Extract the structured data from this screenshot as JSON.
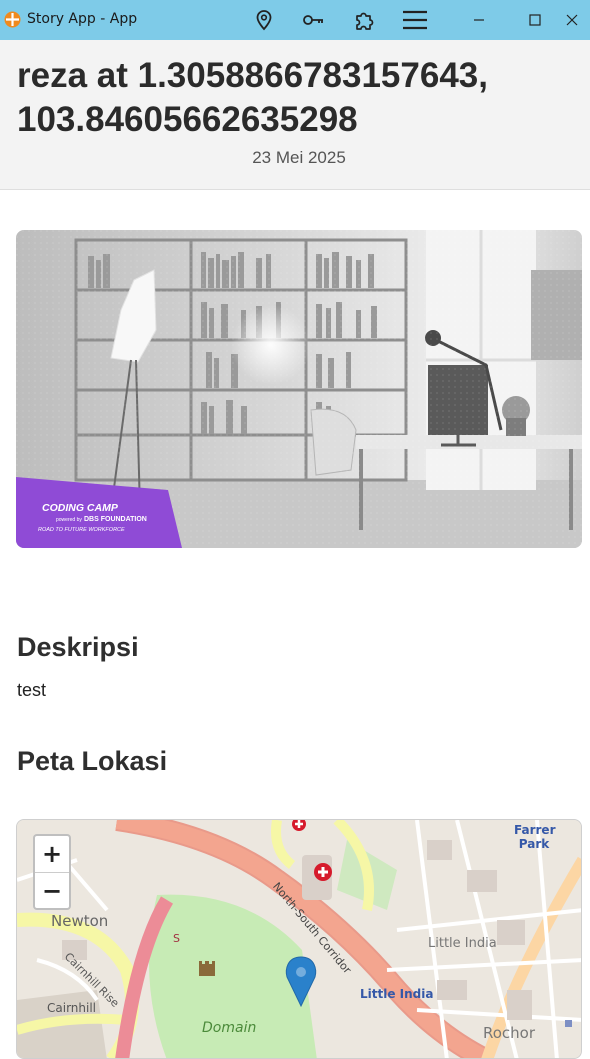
{
  "window": {
    "title": "Story App - App",
    "toolbar_icons": [
      "location-pin-icon",
      "key-icon",
      "puzzle-extension-icon",
      "hamburger-menu-icon"
    ],
    "controls": [
      "minimize",
      "maximize",
      "close"
    ]
  },
  "story": {
    "title": "reza at 1.3058866783157643, 103.84605662635298",
    "date": "23 Mei 2025",
    "image": {
      "badge_title": "CODING CAMP",
      "badge_powered": "powered by",
      "badge_foundation": "DBS FOUNDATION",
      "badge_tagline": "ROAD TO FUTURE WORKFORCE"
    }
  },
  "description": {
    "heading": "Deskripsi",
    "text": "test"
  },
  "map": {
    "heading": "Peta Lokasi",
    "zoom_in": "+",
    "zoom_out": "−",
    "labels": {
      "newton": "Newton",
      "cairnhill_rise": "Cairnhill Rise",
      "cairnhill": "Cairnhill",
      "north_south": "North-South Corridor",
      "little_india_area": "Little India",
      "little_india_station": "Little India",
      "farrer_park": "Farrer Park",
      "domain": "Domain",
      "rochor": "Rochor",
      "s_marker": "S"
    },
    "colors": {
      "primary_road": "#f3a58f",
      "secondary_road": "#f6f7a6",
      "park": "#c7ebb5",
      "marker": "#2a81cb"
    }
  }
}
